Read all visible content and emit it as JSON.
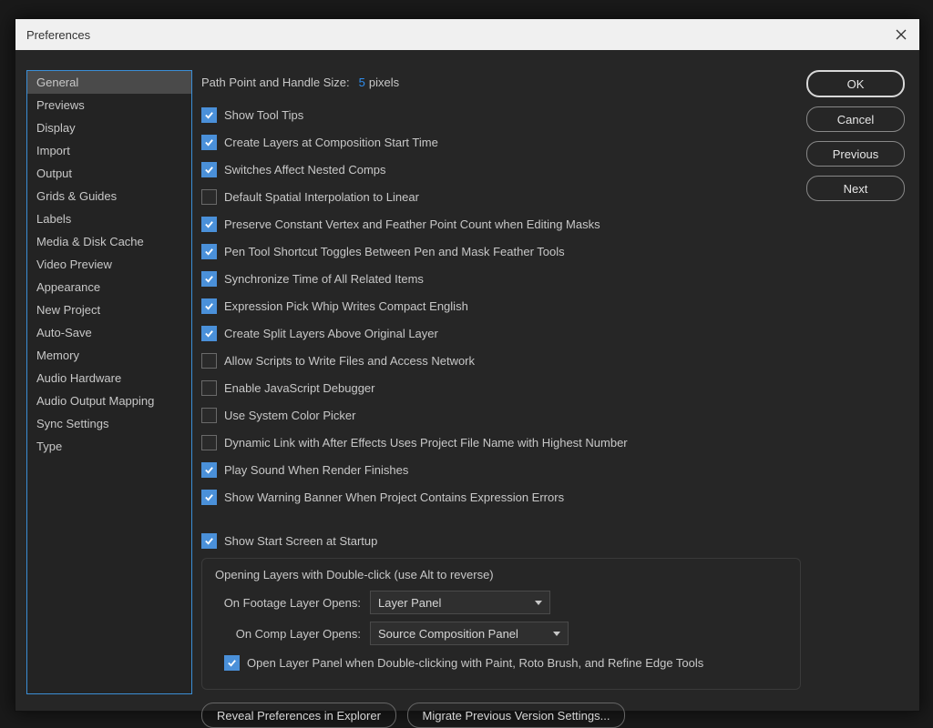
{
  "window": {
    "title": "Preferences"
  },
  "sidebar": {
    "items": [
      "General",
      "Previews",
      "Display",
      "Import",
      "Output",
      "Grids & Guides",
      "Labels",
      "Media & Disk Cache",
      "Video Preview",
      "Appearance",
      "New Project",
      "Auto-Save",
      "Memory",
      "Audio Hardware",
      "Audio Output Mapping",
      "Sync Settings",
      "Type"
    ],
    "selected_index": 0
  },
  "path_point": {
    "label": "Path Point and Handle Size:",
    "value": "5",
    "unit": "pixels"
  },
  "checks": [
    {
      "label": "Show Tool Tips",
      "checked": true
    },
    {
      "label": "Create Layers at Composition Start Time",
      "checked": true
    },
    {
      "label": "Switches Affect Nested Comps",
      "checked": true
    },
    {
      "label": "Default Spatial Interpolation to Linear",
      "checked": false
    },
    {
      "label": "Preserve Constant Vertex and Feather Point Count when Editing Masks",
      "checked": true
    },
    {
      "label": "Pen Tool Shortcut Toggles Between Pen and Mask Feather Tools",
      "checked": true
    },
    {
      "label": "Synchronize Time of All Related Items",
      "checked": true
    },
    {
      "label": "Expression Pick Whip Writes Compact English",
      "checked": true
    },
    {
      "label": "Create Split Layers Above Original Layer",
      "checked": true
    },
    {
      "label": "Allow Scripts to Write Files and Access Network",
      "checked": false
    },
    {
      "label": "Enable JavaScript Debugger",
      "checked": false
    },
    {
      "label": "Use System Color Picker",
      "checked": false
    },
    {
      "label": "Dynamic Link with After Effects Uses Project File Name with Highest Number",
      "checked": false
    },
    {
      "label": "Play Sound When Render Finishes",
      "checked": true
    },
    {
      "label": "Show Warning Banner When Project Contains Expression Errors",
      "checked": true
    }
  ],
  "startup_check": {
    "label": "Show Start Screen at Startup",
    "checked": true
  },
  "double_click_group": {
    "title": "Opening Layers with Double-click (use Alt to reverse)",
    "footage_label": "On Footage Layer Opens:",
    "footage_value": "Layer Panel",
    "comp_label": "On Comp Layer Opens:",
    "comp_value": "Source Composition Panel",
    "open_layer_panel": {
      "label": "Open Layer Panel when Double-clicking with Paint, Roto Brush, and Refine Edge Tools",
      "checked": true
    }
  },
  "bottom_buttons": {
    "reveal": "Reveal Preferences in Explorer",
    "migrate": "Migrate Previous Version Settings..."
  },
  "right_buttons": {
    "ok": "OK",
    "cancel": "Cancel",
    "previous": "Previous",
    "next": "Next"
  }
}
